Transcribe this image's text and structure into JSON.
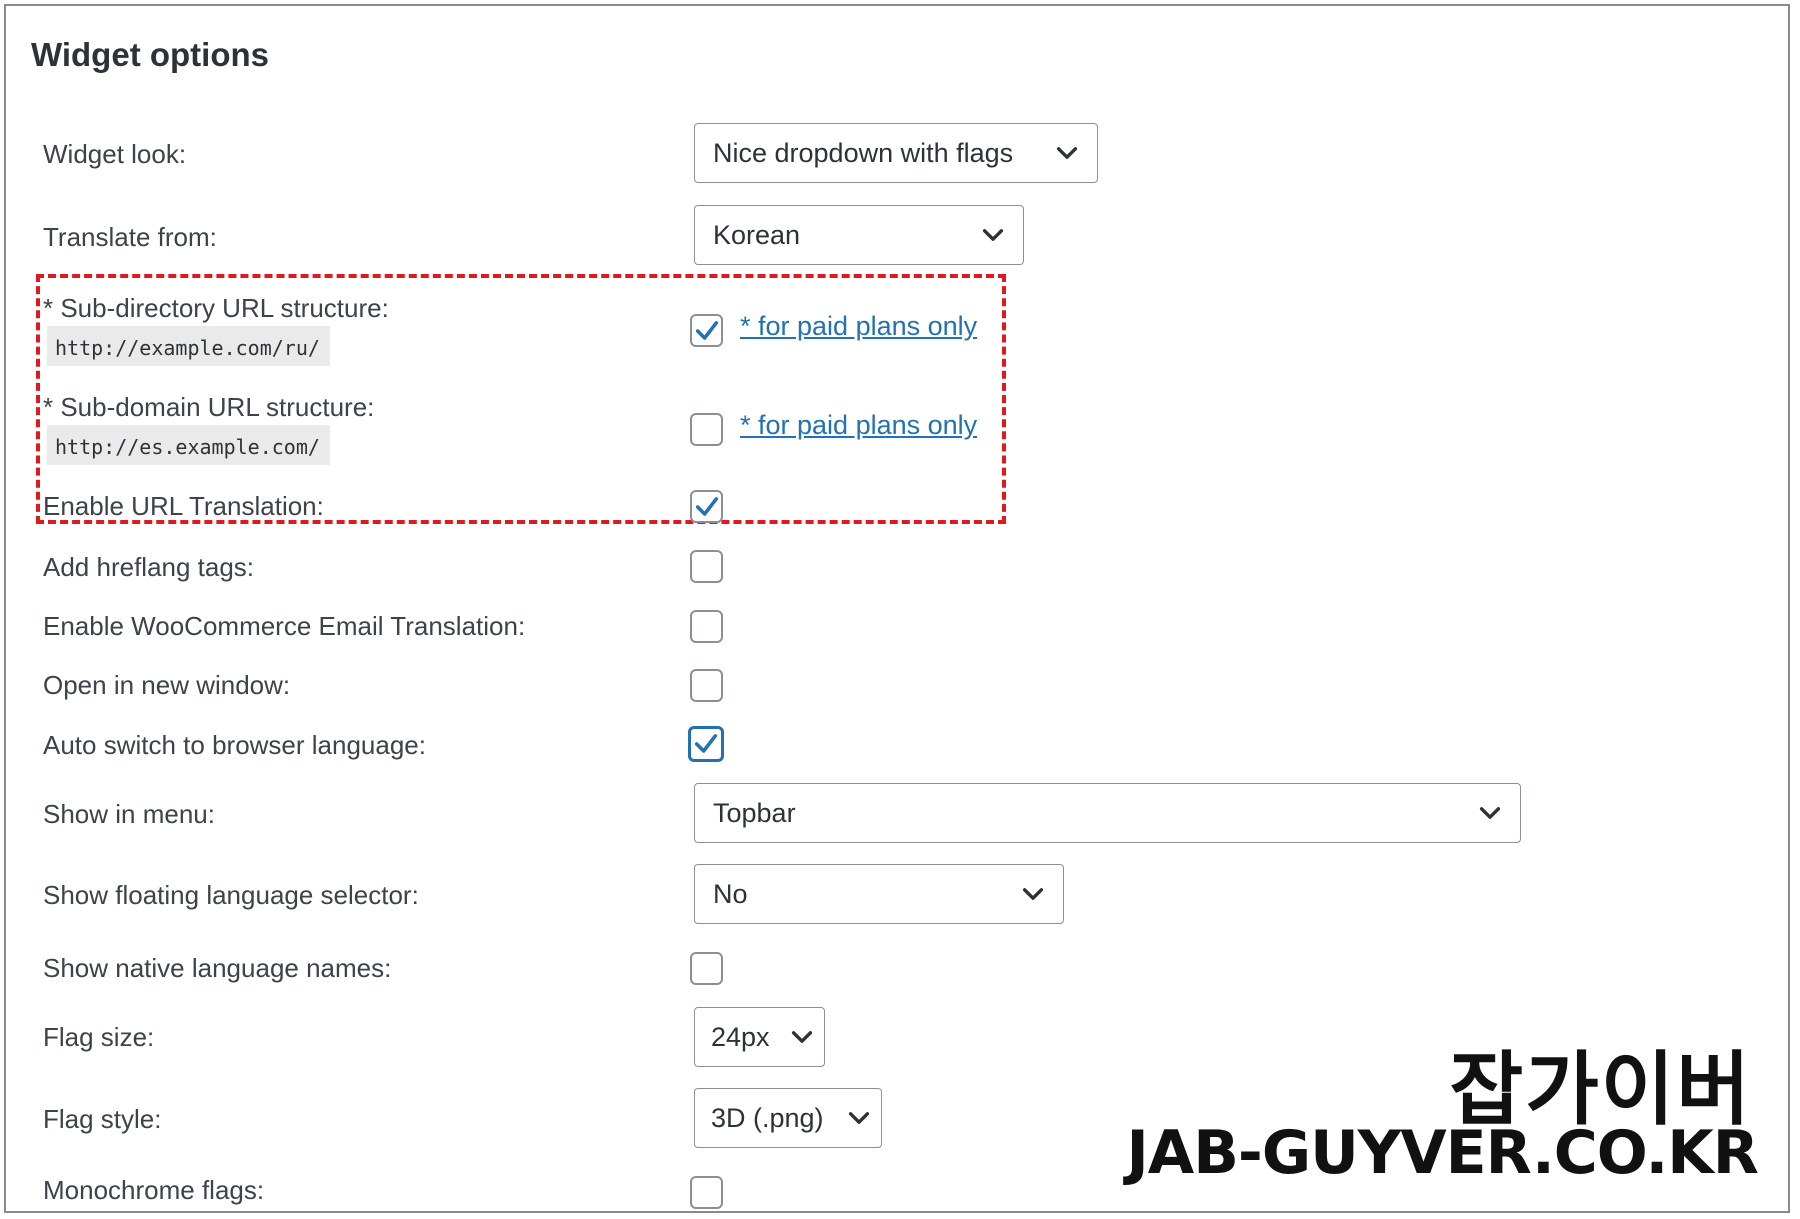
{
  "title": "Widget options",
  "rows": {
    "widget_look": {
      "label": "Widget look:",
      "value": "Nice dropdown with flags"
    },
    "translate_from": {
      "label": "Translate from:",
      "value": "Korean"
    },
    "sub_directory": {
      "label": "* Sub-directory URL structure:",
      "example": "http://example.com/ru/",
      "checked": true,
      "link": "* for paid plans only"
    },
    "sub_domain": {
      "label": "* Sub-domain URL structure:",
      "example": "http://es.example.com/",
      "checked": false,
      "link": "* for paid plans only"
    },
    "url_translation": {
      "label": "Enable URL Translation:",
      "checked": true
    },
    "hreflang": {
      "label": "Add hreflang tags:",
      "checked": false
    },
    "woocommerce_email": {
      "label": "Enable WooCommerce Email Translation:",
      "checked": false
    },
    "new_window": {
      "label": "Open in new window:",
      "checked": false
    },
    "auto_switch": {
      "label": "Auto switch to browser language:",
      "checked": true
    },
    "show_in_menu": {
      "label": "Show in menu:",
      "value": "Topbar"
    },
    "floating_selector": {
      "label": "Show floating language selector:",
      "value": "No"
    },
    "native_names": {
      "label": "Show native language names:",
      "checked": false
    },
    "flag_size": {
      "label": "Flag size:",
      "value": "24px"
    },
    "flag_style": {
      "label": "Flag style:",
      "value": "3D (.png)"
    },
    "monochrome": {
      "label": "Monochrome flags:",
      "checked": false
    }
  },
  "watermark": {
    "korean": "잡가이버",
    "english": "JAB-GUYVER.CO.KR"
  },
  "colors": {
    "accent": "#2271b1",
    "highlight_border": "#e0191f"
  }
}
